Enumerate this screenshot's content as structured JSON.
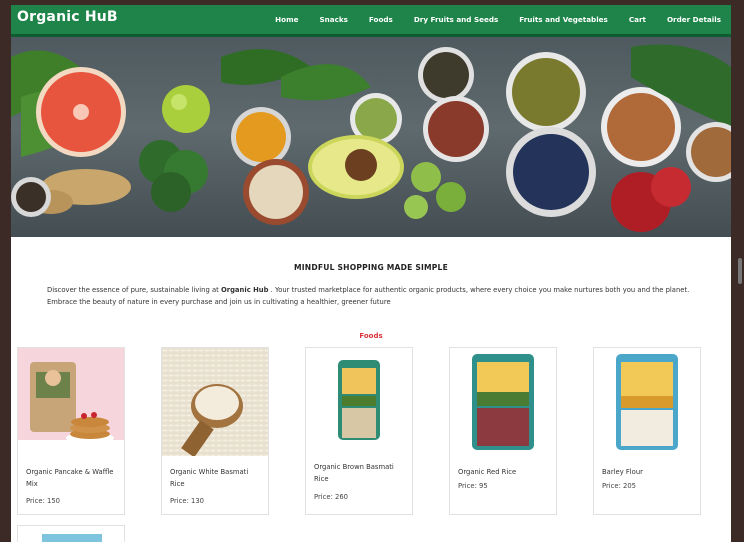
{
  "brand": "Organic HuB",
  "nav": [
    "Home",
    "Snacks",
    "Foods",
    "Dry Fruits and Seeds",
    "Fruits and Vegetables",
    "Cart",
    "Order Details"
  ],
  "colors": {
    "navbar": "#1e8449",
    "accent": "#d9353a"
  },
  "intro": {
    "title": "MINDFUL SHOPPING MADE SIMPLE",
    "text_before": "Discover the essence of pure, sustainable living at ",
    "brand_bold": "Organic Hub",
    "text_after": " . Your trusted marketplace for authentic organic products, where every choice you make nurtures both you and the planet. Embrace the beauty of nature in every purchase and join us in cultivating a healthier, greener future"
  },
  "section_label": "Foods",
  "products": [
    {
      "name": "Organic Pancake & Waffle Mix",
      "price": "Price: 150"
    },
    {
      "name": "Organic White Basmati Rice",
      "price": "Price: 130"
    },
    {
      "name": "Organic Brown Basmati Rice",
      "price": "Price: 260"
    },
    {
      "name": "Organic Red Rice",
      "price": "Price: 95"
    },
    {
      "name": "Barley Flour",
      "price": "Price: 205"
    }
  ]
}
